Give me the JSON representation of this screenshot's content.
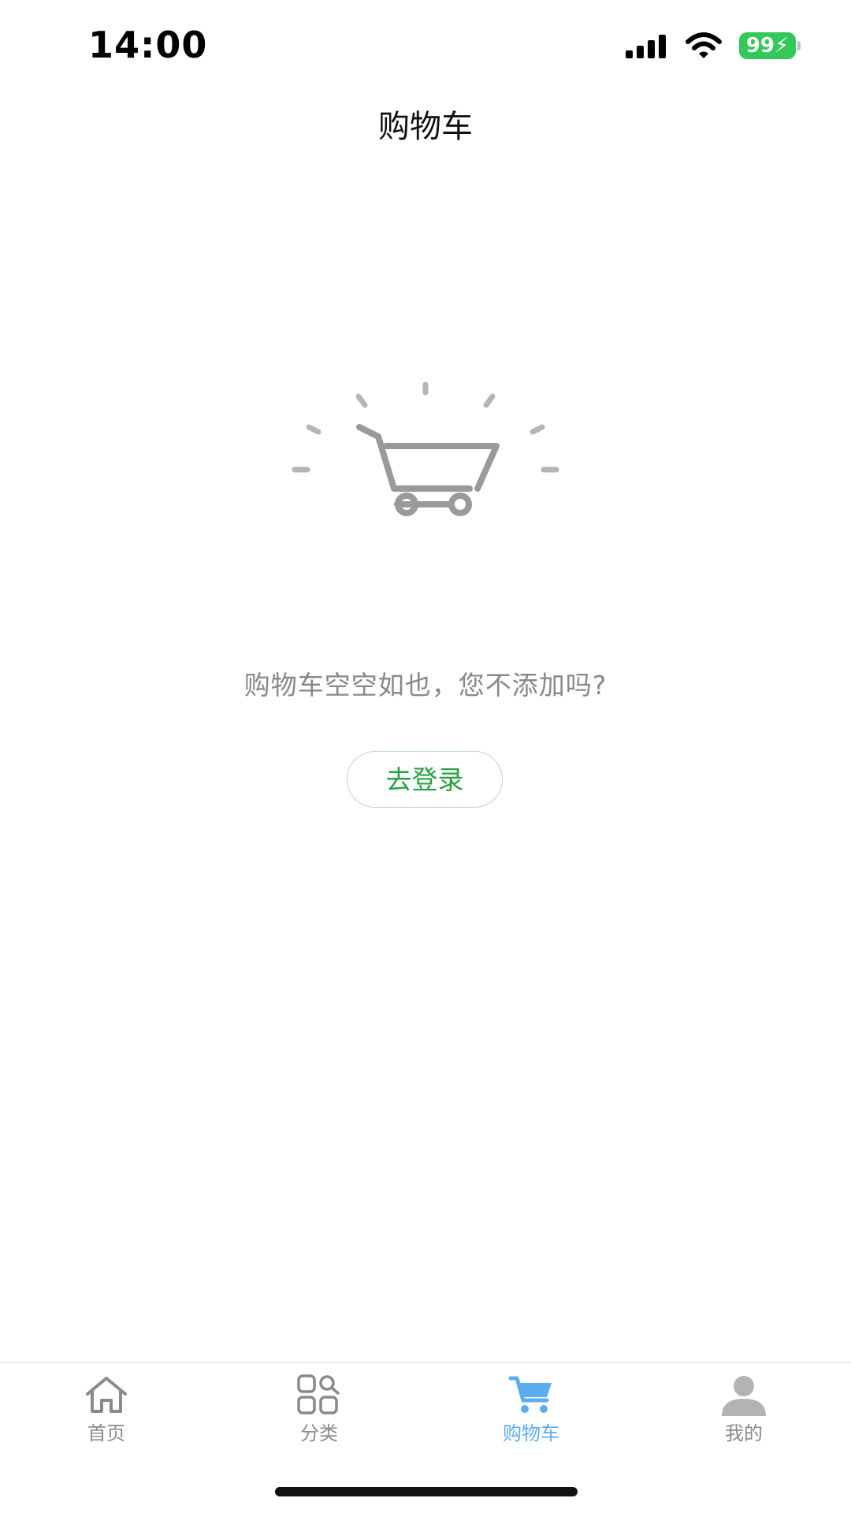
{
  "status_bar": {
    "time": "14:00",
    "battery_level": "99",
    "icons": [
      "cellular-signal-icon",
      "wifi-icon",
      "battery-charging-icon"
    ]
  },
  "nav": {
    "title": "购物车"
  },
  "empty_state": {
    "illustration_icon": "empty-cart-icon",
    "message": "购物车空空如也，您不添加吗?",
    "login_button_label": "去登录"
  },
  "tab_bar": {
    "items": [
      {
        "label": "首页",
        "icon": "home-icon",
        "active": false
      },
      {
        "label": "分类",
        "icon": "category-icon",
        "active": false
      },
      {
        "label": "购物车",
        "icon": "cart-icon",
        "active": true
      },
      {
        "label": "我的",
        "icon": "user-icon",
        "active": false
      }
    ]
  },
  "colors": {
    "accent_green": "#2aa043",
    "active_tab_blue": "#5aaef0",
    "inactive_gray": "#8a8a8a",
    "battery_green": "#34c759"
  }
}
